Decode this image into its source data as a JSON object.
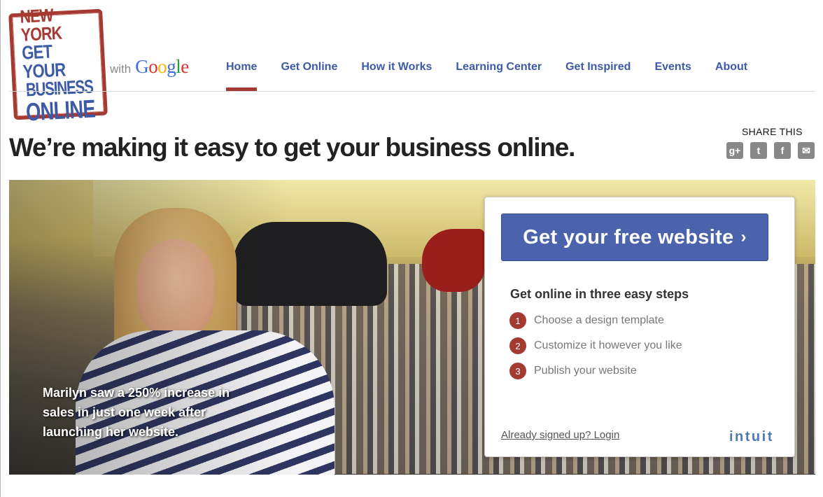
{
  "logo": {
    "lines": [
      "NEW YORK",
      "GET YOUR",
      "BUSINESS",
      "ONLINE"
    ]
  },
  "with_google": {
    "with": "with",
    "google_letters": [
      "G",
      "o",
      "o",
      "g",
      "l",
      "e"
    ],
    "google_colors": [
      "#3b6ce3",
      "#d9342b",
      "#f1b80e",
      "#3b6ce3",
      "#2e9c3e",
      "#d9342b"
    ]
  },
  "nav": {
    "items": [
      "Home",
      "Get Online",
      "How it Works",
      "Learning Center",
      "Get Inspired",
      "Events",
      "About"
    ],
    "active": "Home"
  },
  "headline": "We’re making it easy to get your business online.",
  "share": {
    "label": "SHARE THIS",
    "icons": [
      "google-plus-icon",
      "twitter-icon",
      "facebook-icon",
      "email-icon"
    ],
    "glyphs": [
      "g+",
      "t",
      "f",
      "✉"
    ]
  },
  "hero": {
    "caption": "Marilyn saw a 250% increase in sales in just one week after launching her website."
  },
  "card": {
    "cta_label": "Get your free website",
    "cta_chevron": "›",
    "steps_title": "Get online in three easy steps",
    "steps": [
      {
        "num": "1",
        "text": "Choose a design template"
      },
      {
        "num": "2",
        "text": "Customize it however you like"
      },
      {
        "num": "3",
        "text": "Publish your website"
      }
    ],
    "login_link": "Already signed up? Login",
    "brand": "intuit"
  },
  "colors": {
    "accent_red": "#a53a33",
    "brand_blue": "#3d5aa6",
    "cta_blue": "#4b62ac"
  }
}
